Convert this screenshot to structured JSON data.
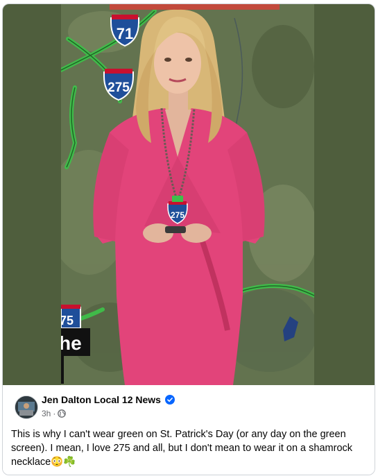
{
  "video": {
    "shields": [
      "71",
      "275",
      "275"
    ],
    "overlay_text": "he",
    "left_edge_shield": "75"
  },
  "post": {
    "author_name": "Jen Dalton Local 12 News",
    "timestamp": "3h",
    "separator": "·",
    "body": "This is why I can't wear green on St. Patrick's Day (or any day on the green screen). I mean, I love 275 and all, but I don't mean to wear it on a shamrock necklace😳☘️"
  },
  "icons": [
    "verified-badge-icon",
    "globe-icon"
  ],
  "colors": {
    "side_bar": "#4f5e3d",
    "interstate_blue": "#1f4f9a",
    "interstate_red": "#c8102e",
    "highway_green": "#3fbf4a",
    "dress_pink": "#e2447a",
    "verified_blue": "#0866ff"
  }
}
